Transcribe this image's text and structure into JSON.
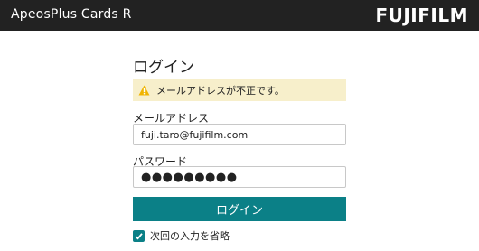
{
  "header": {
    "app_title": "ApeosPlus Cards R",
    "brand": "FUJIFILM"
  },
  "login": {
    "heading": "ログイン",
    "alert_message": "メールアドレスが不正です。",
    "email_label": "メールアドレス",
    "email_value": "fuji.taro@fujifilm.com",
    "password_label": "パスワード",
    "password_masked": "●●●●●●●●●",
    "login_button": "ログイン",
    "remember_label": "次回の入力を省略",
    "remember_checked": true
  },
  "colors": {
    "topbar": "#222222",
    "accent": "#0b8087",
    "alert_background": "#f7efcb",
    "warning": "#f0b400"
  },
  "icons": {
    "alert": "warning-icon",
    "checkbox": "checkmark-icon"
  }
}
